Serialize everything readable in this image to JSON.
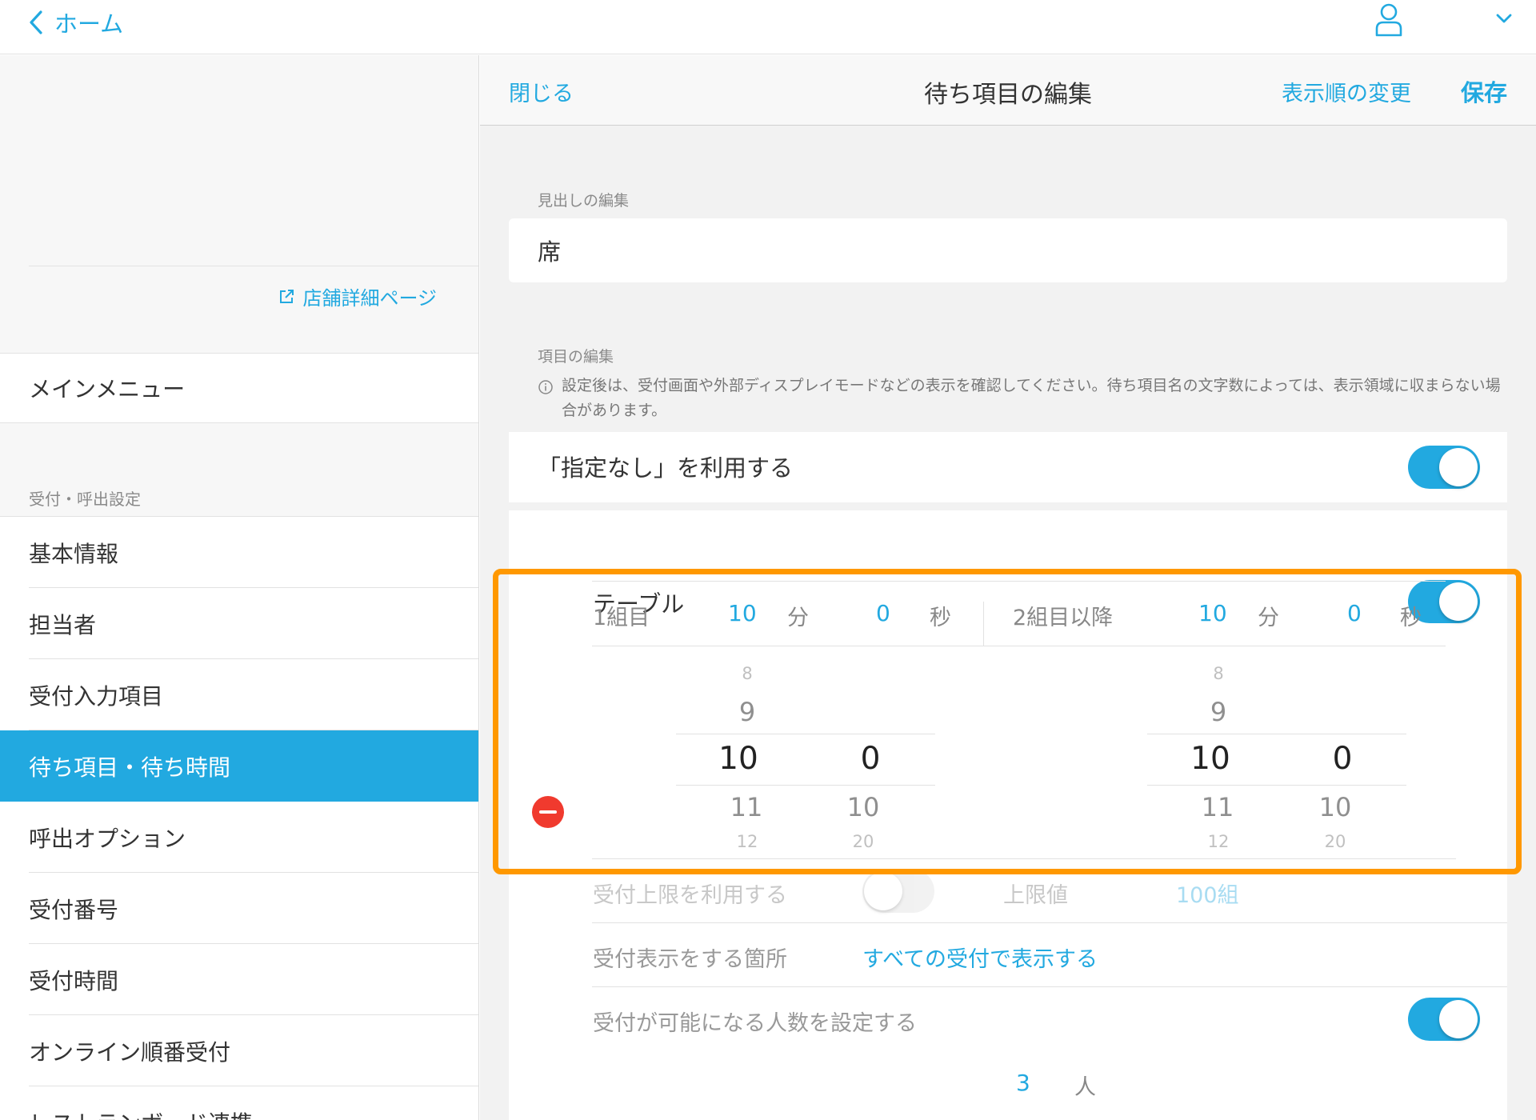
{
  "topbar": {
    "back_label": "ホーム",
    "icons": {
      "back": "chevron-left-icon",
      "user": "user-icon",
      "menu": "chevron-down-icon"
    }
  },
  "sidebar": {
    "shop_link": "店舗詳細ページ",
    "main_menu": "メインメニュー",
    "section_label": "受付・呼出設定",
    "items": [
      {
        "label": "基本情報",
        "active": false
      },
      {
        "label": "担当者",
        "active": false
      },
      {
        "label": "受付入力項目",
        "active": false
      },
      {
        "label": "待ち項目・待ち時間",
        "active": true
      },
      {
        "label": "呼出オプション",
        "active": false
      },
      {
        "label": "受付番号",
        "active": false
      },
      {
        "label": "受付時間",
        "active": false
      },
      {
        "label": "オンライン順番受付",
        "active": false
      },
      {
        "label": "レストランボード連携",
        "active": false
      }
    ]
  },
  "header": {
    "close_label": "閉じる",
    "title": "待ち項目の編集",
    "order_label": "表示順の変更",
    "save_label": "保存"
  },
  "heading_section": {
    "caption": "見出しの編集",
    "value": "席"
  },
  "items_section": {
    "caption": "項目の編集",
    "note": "設定後は、受付画面や外部ディスプレイモードなどの表示を確認してください。待ち項目名の文字数によっては、表示領域に収まらない場合があります。"
  },
  "no_preference": {
    "label": "「指定なし」を利用する",
    "enabled": true
  },
  "table_item": {
    "name": "テーブル",
    "enabled": true,
    "first_group": {
      "label": "1組目",
      "minutes": "10",
      "min_unit": "分",
      "seconds": "0",
      "sec_unit": "秒"
    },
    "later_groups": {
      "label": "2組目以降",
      "minutes": "10",
      "min_unit": "分",
      "seconds": "0",
      "sec_unit": "秒"
    },
    "picker_left": {
      "minutes": {
        "prev2": "8",
        "prev1": "9",
        "selected": "10",
        "next1": "11",
        "next2": "12"
      },
      "seconds": {
        "selected": "0",
        "next1": "10",
        "next2": "20"
      }
    },
    "picker_right": {
      "minutes": {
        "prev2": "8",
        "prev1": "9",
        "selected": "10",
        "next1": "11",
        "next2": "12"
      },
      "seconds": {
        "selected": "0",
        "next1": "10",
        "next2": "20"
      }
    },
    "reception_limit": {
      "label": "受付上限を利用する",
      "enabled": false,
      "limit_label": "上限値",
      "limit_value": "100組"
    },
    "display_location": {
      "label": "受付表示をする箇所",
      "value": "すべての受付で表示する"
    },
    "people_setting": {
      "label": "受付が可能になる人数を設定する",
      "enabled": true,
      "count": "3",
      "unit": "人"
    }
  },
  "colors": {
    "accent": "#22a9e0",
    "highlight": "#ff9800",
    "delete": "#f03a2e"
  }
}
